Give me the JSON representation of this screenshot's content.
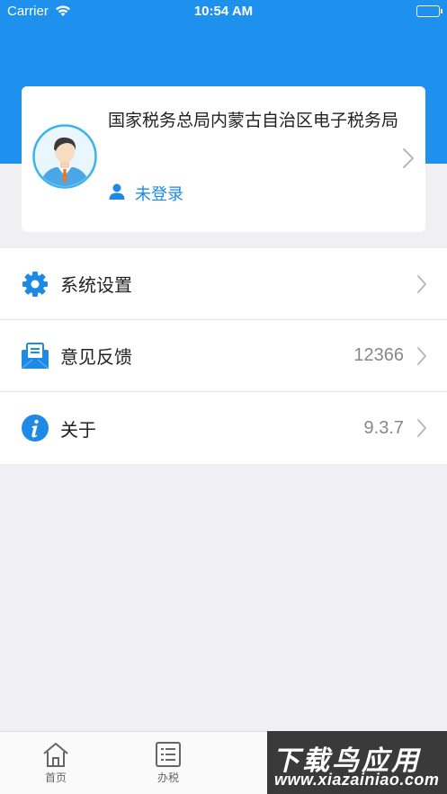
{
  "status_bar": {
    "carrier": "Carrier",
    "time": "10:54 AM"
  },
  "profile": {
    "org_name": "国家税务总局内蒙古自治区电子税务局",
    "login_status": "未登录",
    "avatar_icon": "person-avatar-icon"
  },
  "menu": {
    "items": [
      {
        "label": "系统设置",
        "value": "",
        "icon": "gear-icon"
      },
      {
        "label": "意见反馈",
        "value": "12366",
        "icon": "feedback-mail-icon"
      },
      {
        "label": "关于",
        "value": "9.3.7",
        "icon": "info-icon"
      }
    ]
  },
  "tabbar": {
    "tabs": [
      {
        "label": "首页",
        "icon": "home-icon"
      },
      {
        "label": "办税",
        "icon": "list-icon"
      }
    ]
  },
  "watermark": {
    "title": "下载鸟应用",
    "url": "www.xiazainiao.com"
  },
  "colors": {
    "header_blue": "#1e90ee",
    "accent_blue": "#1e8ae6",
    "background": "#efeff4"
  }
}
